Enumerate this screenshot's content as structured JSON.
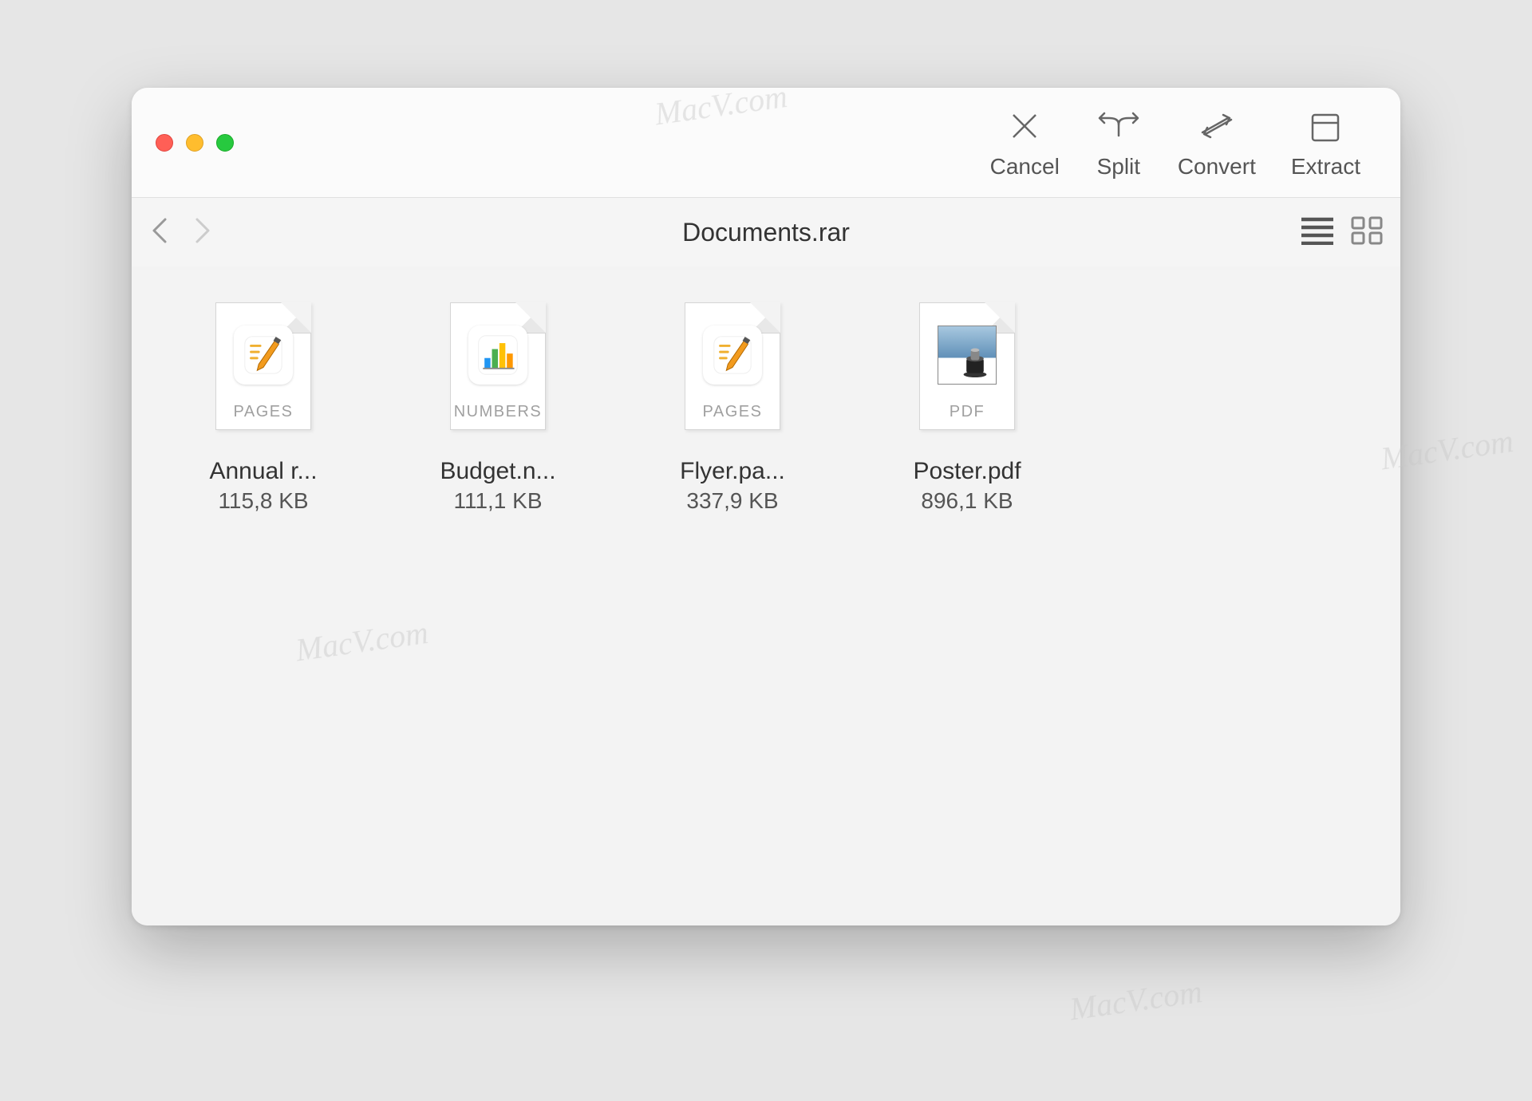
{
  "watermark": "MacV.com",
  "toolbar": {
    "cancel": "Cancel",
    "split": "Split",
    "convert": "Convert",
    "extract": "Extract"
  },
  "archive": {
    "title": "Documents.rar"
  },
  "files": [
    {
      "name": "Annual r...",
      "size": "115,8 KB",
      "type": "PAGES"
    },
    {
      "name": "Budget.n...",
      "size": "111,1 KB",
      "type": "NUMBERS"
    },
    {
      "name": "Flyer.pa...",
      "size": "337,9 KB",
      "type": "PAGES"
    },
    {
      "name": "Poster.pdf",
      "size": "896,1 KB",
      "type": "PDF"
    }
  ]
}
